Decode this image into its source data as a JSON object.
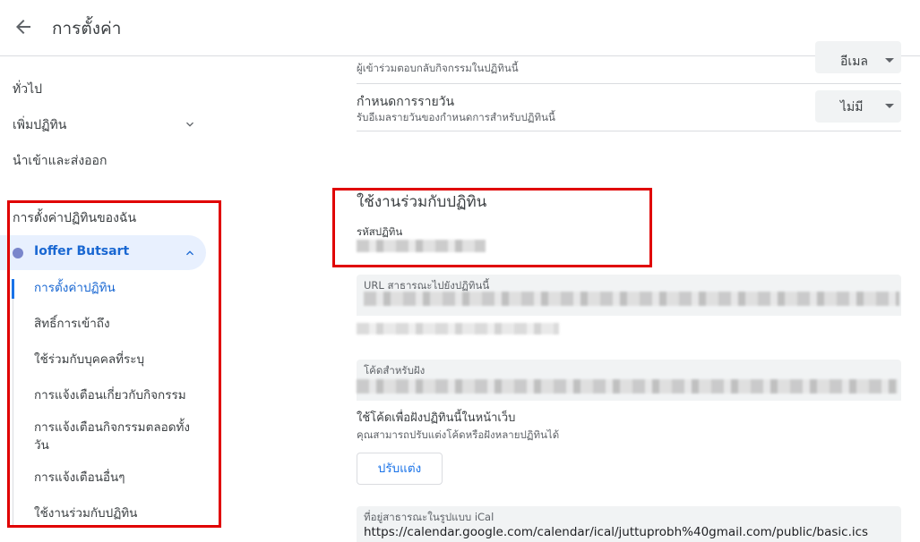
{
  "header": {
    "title": "การตั้งค่า"
  },
  "sidebar": {
    "items": [
      {
        "label": "ทั่วไป"
      },
      {
        "label": "เพิ่มปฏิทิน"
      },
      {
        "label": "นำเข้าและส่งออก"
      }
    ],
    "my_calendars_title": "การตั้งค่าปฏิทินของฉัน",
    "calendar": {
      "name": "Ioffer Butsart",
      "color": "#7986cb",
      "subitems": [
        {
          "label": "การตั้งค่าปฏิทิน"
        },
        {
          "label": "สิทธิ์การเข้าถึง"
        },
        {
          "label": "ใช้ร่วมกับบุคคลที่ระบุ"
        },
        {
          "label": "การแจ้งเตือนเกี่ยวกับกิจกรรม"
        },
        {
          "label": "การแจ้งเตือนกิจกรรมตลอดทั้งวัน"
        },
        {
          "label": "การแจ้งเตือนอื่นๆ"
        },
        {
          "label": "ใช้งานร่วมกับปฏิทิน"
        }
      ]
    }
  },
  "main": {
    "rsvp": {
      "subtitle": "ผู้เข้าร่วมตอบกลับกิจกรรมในปฏิทินนี้",
      "value": "อีเมล"
    },
    "daily_agenda": {
      "title": "กำหนดการรายวัน",
      "subtitle": "รับอีเมลรายวันของกำหนดการสำหรับปฏิทินนี้",
      "value": "ไม่มี"
    },
    "integrate": {
      "heading": "ใช้งานร่วมกับปฏิทิน",
      "calendar_id_label": "รหัสปฏิทิน",
      "public_url_label": "URL สาธารณะไปยังปฏิทินนี้",
      "embed_label": "โค้ดสำหรับฝัง",
      "embed_help": "ใช้โค้ดเพื่อฝังปฏิทินนี้ในหน้าเว็บ",
      "embed_help_sub": "คุณสามารถปรับแต่งโค้ดหรือฝังหลายปฏิทินได้",
      "customize_button": "ปรับแต่ง",
      "ical_label": "ที่อยู่สาธารณะในรูปแบบ iCal",
      "ical_value": "https://calendar.google.com/calendar/ical/juttuprobh%40gmail.com/public/basic.ics"
    }
  }
}
